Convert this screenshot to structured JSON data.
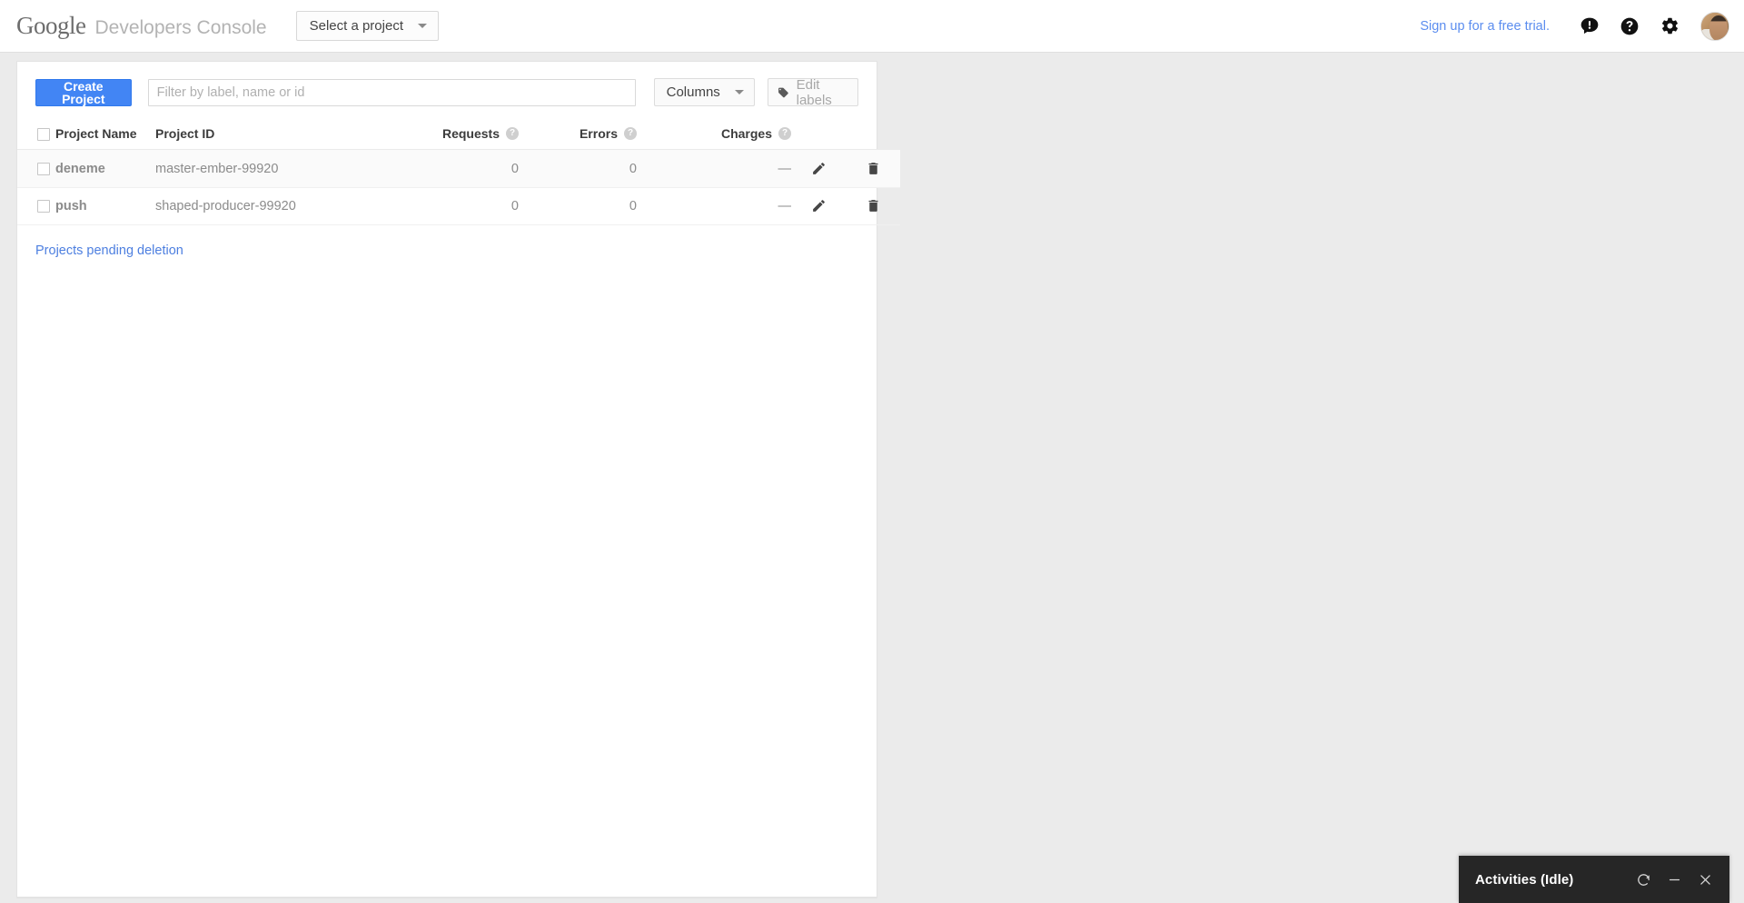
{
  "header": {
    "brand_google": "Google",
    "brand_product": "Developers Console",
    "project_selector_label": "Select a project",
    "trial_link": "Sign up for a free trial.",
    "icons": {
      "alert": "alert-bubble-icon",
      "help": "help-circle-icon",
      "settings": "gear-icon",
      "avatar": "user-avatar"
    }
  },
  "toolbar": {
    "create_project_label": "Create Project",
    "filter_value": "",
    "filter_placeholder": "Filter by label, name or id",
    "columns_label": "Columns",
    "edit_labels_label": "Edit labels",
    "edit_labels_icon": "tag-icon",
    "edit_labels_disabled": true
  },
  "table": {
    "columns": [
      {
        "key": "check",
        "label": "",
        "has_help": false
      },
      {
        "key": "name",
        "label": "Project Name",
        "has_help": false
      },
      {
        "key": "id",
        "label": "Project ID",
        "has_help": false
      },
      {
        "key": "requests",
        "label": "Requests",
        "has_help": true
      },
      {
        "key": "errors",
        "label": "Errors",
        "has_help": true
      },
      {
        "key": "charges",
        "label": "Charges",
        "has_help": true
      }
    ],
    "headers": {
      "project_name": "Project Name",
      "project_id": "Project ID",
      "requests": "Requests",
      "errors": "Errors",
      "charges": "Charges"
    },
    "rows": [
      {
        "project_name": "deneme",
        "project_id": "master-ember-99920",
        "requests": "0",
        "errors": "0",
        "charges": "—",
        "selected": false
      },
      {
        "project_name": "push",
        "project_id": "shaped-producer-99920",
        "requests": "0",
        "errors": "0",
        "charges": "—",
        "selected": false
      }
    ],
    "select_all_checked": false
  },
  "links": {
    "pending_deletion": "Projects pending deletion"
  },
  "activities": {
    "title": "Activities (Idle)",
    "refresh_icon": "refresh-icon",
    "minimize_icon": "minimize-icon",
    "close_icon": "close-icon"
  },
  "colors": {
    "accent_blue": "#4285f4",
    "link_blue": "#5b8def",
    "page_bg": "#ebebeb",
    "card_bg": "#ffffff",
    "activities_bg": "#262626"
  }
}
